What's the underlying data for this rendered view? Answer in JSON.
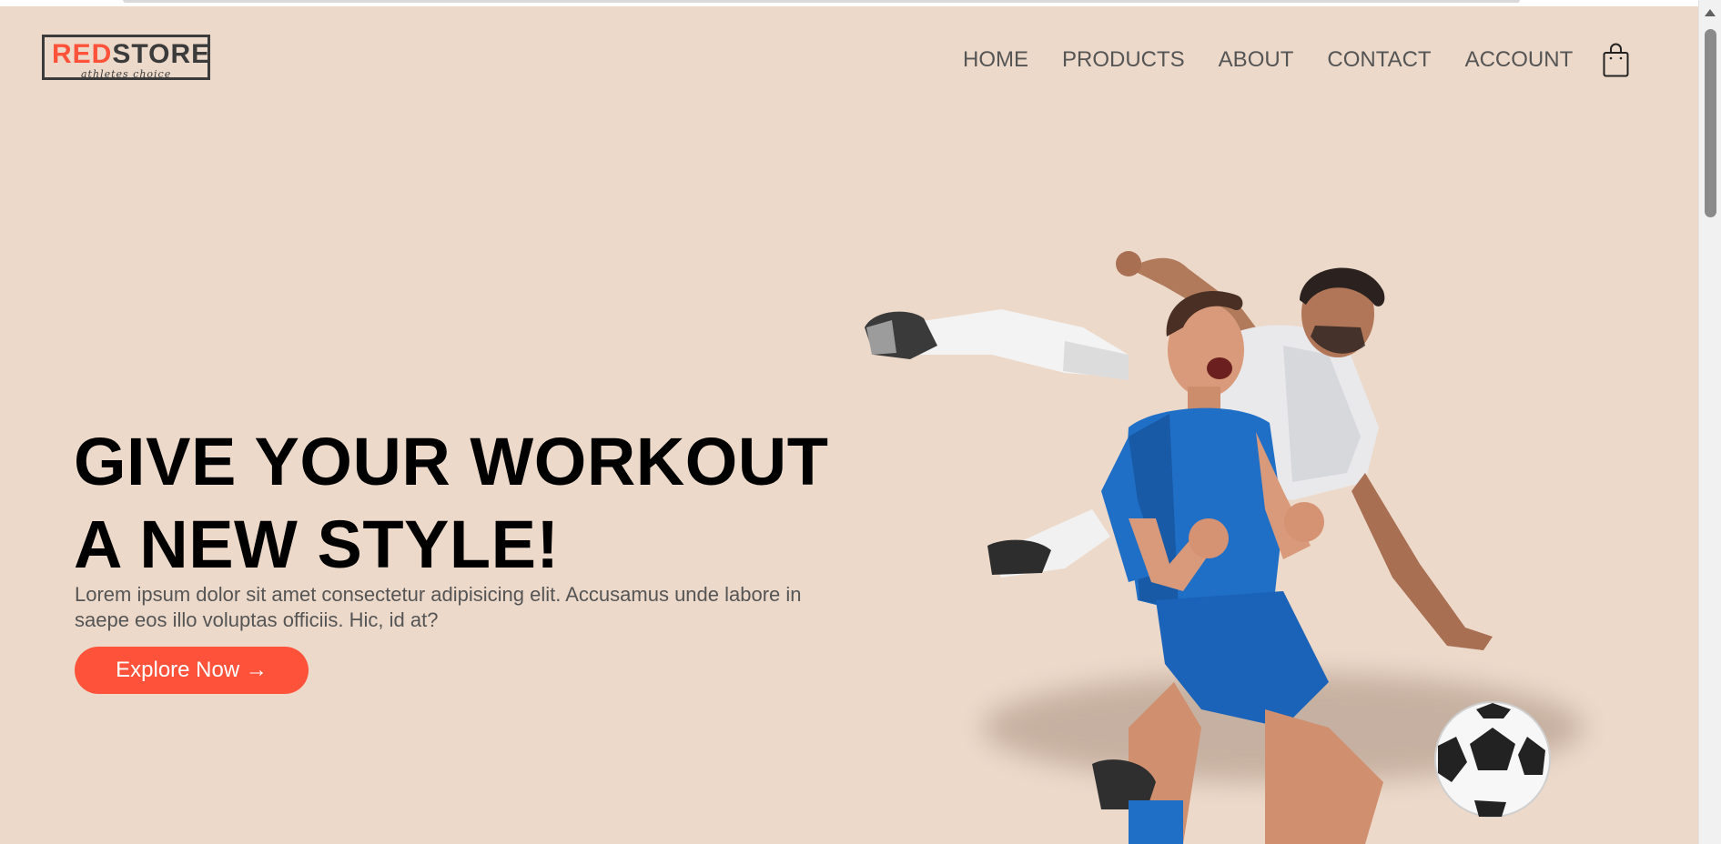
{
  "brand": {
    "logo_part1": "RED",
    "logo_part2": "STORE",
    "tagline": "athletes choice",
    "accent_color": "#ff523b",
    "background_color": "#ecd9ca"
  },
  "nav": {
    "items": [
      {
        "label": "HOME"
      },
      {
        "label": "PRODUCTS"
      },
      {
        "label": "ABOUT"
      },
      {
        "label": "CONTACT"
      },
      {
        "label": "ACCOUNT"
      }
    ],
    "cart_icon": "shopping-bag-icon"
  },
  "hero": {
    "title_line1": "GIVE YOUR WORKOUT",
    "title_line2": "A NEW STYLE!",
    "description": "Lorem ipsum dolor sit amet consectetur adipisicing elit. Accusamus unde labore in saepe eos illo voluptas officiis. Hic, id at?",
    "button_label": "Explore Now →",
    "image_alt": "soccer-players-image"
  }
}
